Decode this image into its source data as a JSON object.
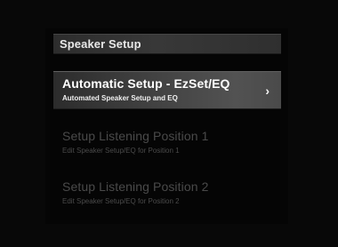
{
  "header": {
    "title": "Speaker Setup"
  },
  "menu": {
    "items": [
      {
        "title": "Automatic Setup - EzSet/EQ",
        "subtitle": "Automated Speaker Setup and EQ",
        "selected": true,
        "arrow": "›"
      },
      {
        "title": "Setup Listening Position 1",
        "subtitle": "Edit Speaker Setup/EQ for Position 1",
        "selected": false
      },
      {
        "title": "Setup Listening Position 2",
        "subtitle": "Edit Speaker Setup/EQ for Position 2",
        "selected": false
      }
    ]
  },
  "colors": {
    "background": "#080808",
    "header_bg": "#353535",
    "selected_bg": "#4a4a4a",
    "selected_text": "#ffffff",
    "disabled_text": "#4a4a4a"
  },
  "icons": {
    "selected_item_arrow": "chevron-right-icon"
  }
}
